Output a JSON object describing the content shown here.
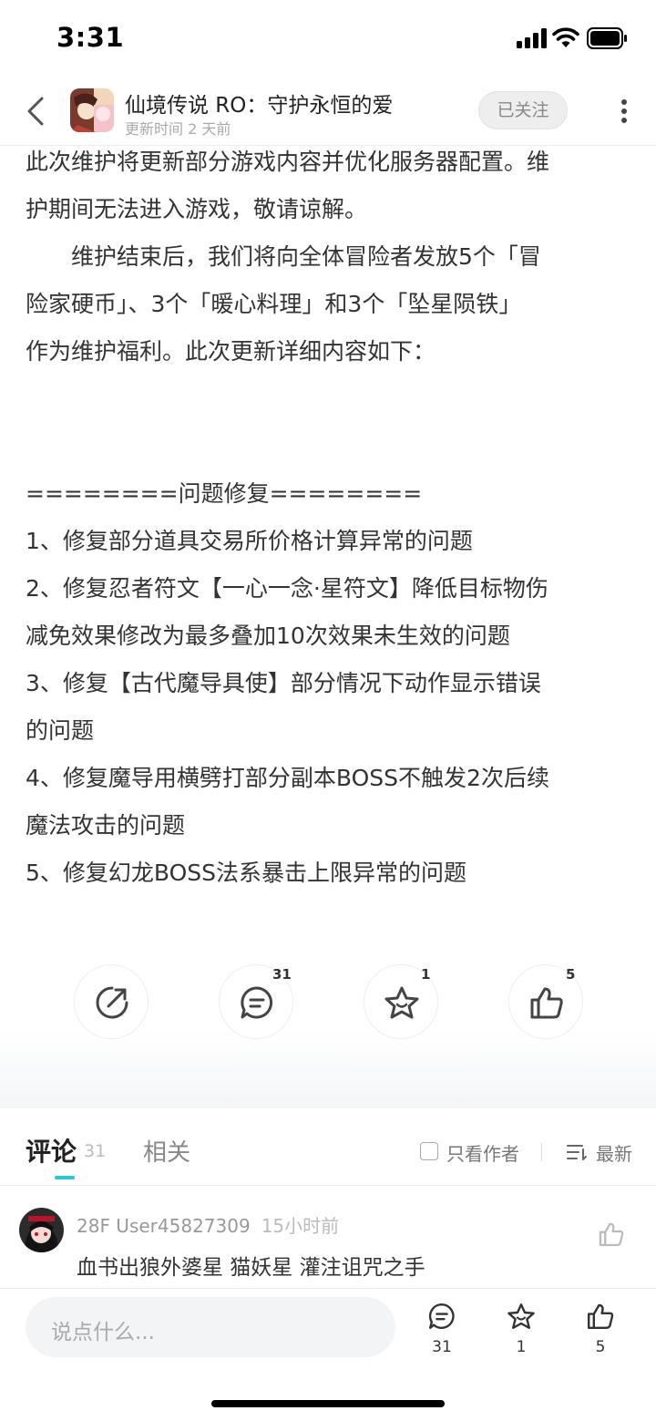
{
  "status_bar": {
    "time": "3:31"
  },
  "header": {
    "title": "仙境传说 RO：守护永恒的爱",
    "update_time": "更新时间 2 天前",
    "follow_label": "已关注"
  },
  "article": {
    "lines": [
      "此次维护将更新部分游戏内容并优化服务器配置。维",
      "护期间无法进入游戏，敬请谅解。",
      "　　维护结束后，我们将向全体冒险者发放5个「冒",
      "险家硬币」、3个「暖心料理」和3个「坠星陨铁」",
      "作为维护福利。此次更新详细内容如下：",
      "",
      "",
      "========问题修复========",
      "1、修复部分道具交易所价格计算异常的问题",
      "2、修复忍者符文【一心一念·星符文】降低目标物伤",
      "减免效果修改为最多叠加10次效果未生效的问题",
      "3、修复【古代魔导具使】部分情况下动作显示错误",
      "的问题",
      "4、修复魔导用横劈打部分副本BOSS不触发2次后续",
      "魔法攻击的问题",
      "5、修复幻龙BOSS法系暴击上限异常的问题"
    ]
  },
  "actions": {
    "share": {
      "icon": "share-icon",
      "count": ""
    },
    "comment": {
      "icon": "comment-icon",
      "count": "31"
    },
    "favorite": {
      "icon": "star-icon",
      "count": "1"
    },
    "like": {
      "icon": "thumbs-up-icon",
      "count": "5"
    }
  },
  "tabs": {
    "comment_label": "评论",
    "comment_count": "31",
    "related_label": "相关",
    "author_only_label": "只看作者",
    "sort_label": "最新"
  },
  "comments": [
    {
      "meta": "28F User45827309",
      "time": "15小时前",
      "text": "血书出狼外婆星 猫妖星 灌注诅咒之手"
    }
  ],
  "bottom_bar": {
    "placeholder": "说点什么...",
    "comment_count": "31",
    "favorite_count": "1",
    "like_count": "5"
  },
  "colors": {
    "accent": "#26c6da",
    "text": "#333333",
    "muted": "#999999"
  }
}
